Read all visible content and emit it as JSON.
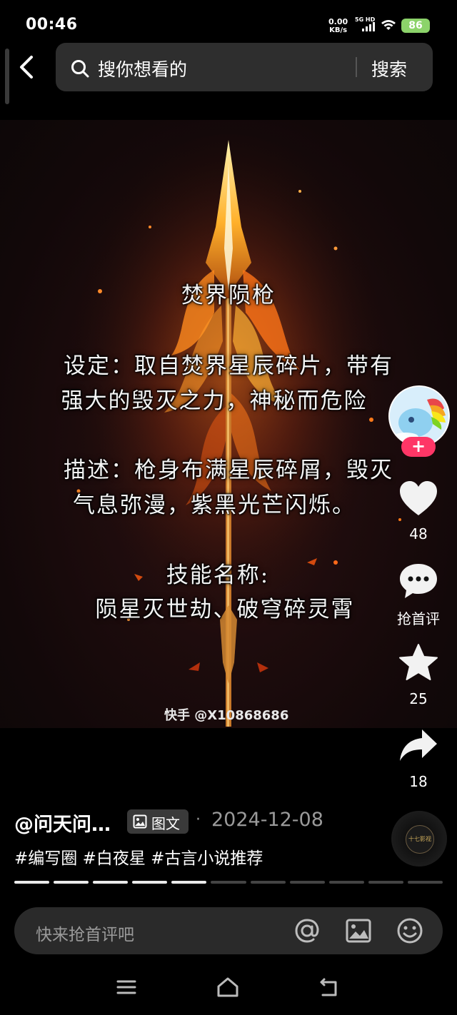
{
  "status_bar": {
    "time": "00:46",
    "net_speed_value": "0.00",
    "net_speed_unit": "KB/s",
    "network_label": "5G HD",
    "battery": "86"
  },
  "search": {
    "placeholder": "搜你想看的",
    "button_label": "搜索"
  },
  "post_image": {
    "title": "焚界陨枪",
    "lines": [
      "设定：取自焚界星辰碎片，带有",
      "强大的毁灭之力，神秘而危险",
      "描述：枪身布满星辰碎屑，毁灭",
      "气息弥漫，紫黑光芒闪烁。",
      "技能名称:",
      "陨星灭世劫、破穹碎灵霄"
    ],
    "watermark": "快手 @X10868686"
  },
  "actions": {
    "follow_label": "+",
    "likes": "48",
    "comment_label": "抢首评",
    "favorites": "25",
    "shares": "18"
  },
  "post_info": {
    "author": "@问天问…",
    "type_badge": "图文",
    "date_separator": "·",
    "date": "2024-12-08",
    "tags": "#编写圈 #白夜星 #古言小说推荐",
    "music_label": "十七影视"
  },
  "progress": {
    "total": 11,
    "current": 5
  },
  "comment_bar": {
    "placeholder": "快来抢首评吧"
  },
  "colors": {
    "accent_follow": "#fe3666",
    "battery": "#8cd36a",
    "muted_text": "#9a9a9a"
  },
  "icons": [
    "back-icon",
    "search-icon",
    "heart-icon",
    "comment-icon",
    "star-icon",
    "share-icon",
    "image-icon",
    "at-icon",
    "emoji-icon",
    "menu-icon",
    "home-icon",
    "return-icon"
  ]
}
